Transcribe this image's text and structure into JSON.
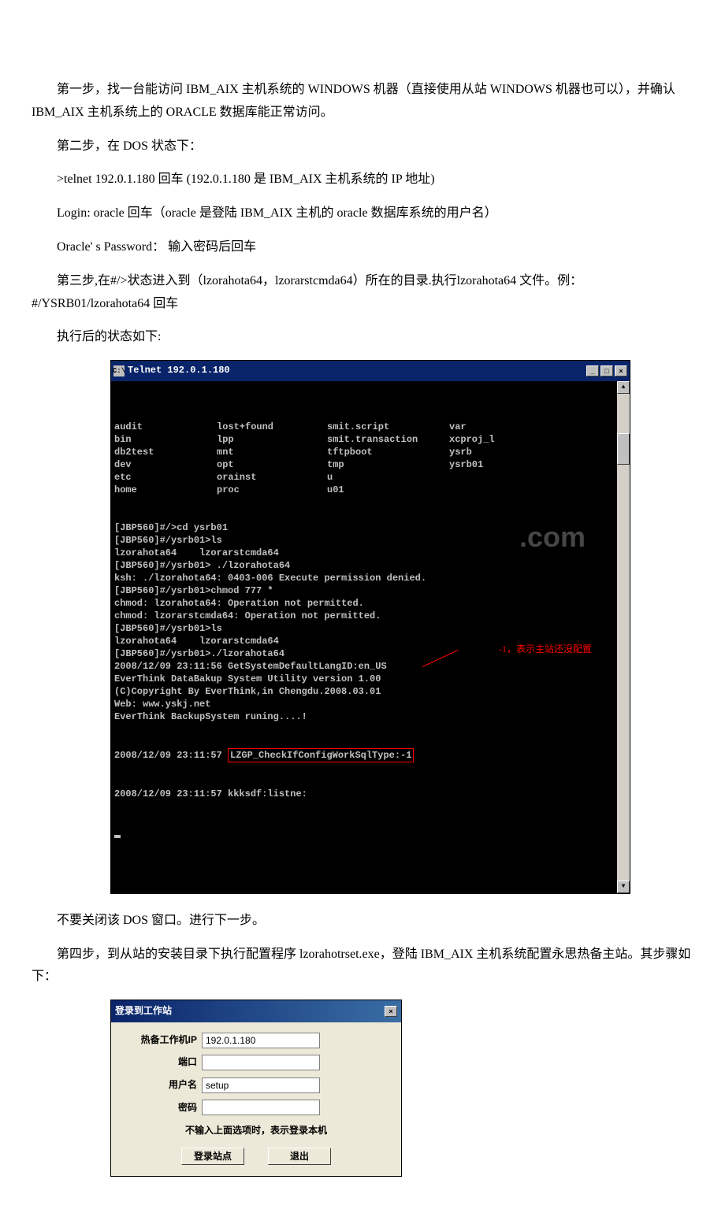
{
  "paragraphs": {
    "p1": "第一步，找一台能访问 IBM_AIX 主机系统的 WINDOWS 机器（直接使用从站 WINDOWS 机器也可以），并确认 IBM_AIX 主机系统上的 ORACLE 数据库能正常访问。",
    "p2": "第二步，在 DOS 状态下：",
    "p3": ">telnet 192.0.1.180 回车 (192.0.1.180 是 IBM_AIX 主机系统的 IP 地址)",
    "p4": "Login: oracle 回车（oracle 是登陆 IBM_AIX 主机的 oracle 数据库系统的用户名）",
    "p5": "Oracle' s Password： 输入密码后回车",
    "p6": "第三步,在#/>状态进入到（lzorahota64，lzorarstcmda64）所在的目录.执行lzorahota64 文件。例：#/YSRB01/lzorahota64 回车",
    "p7": "执行后的状态如下:",
    "p8": "不要关闭该 DOS 窗口。进行下一步。",
    "p9": "第四步，到从站的安装目录下执行配置程序 lzorahotrset.exe，登陆 IBM_AIX 主机系统配置永思热备主站。其步骤如下："
  },
  "telnet": {
    "icon_label": "C:\\",
    "title": "Telnet 192.0.1.180",
    "watermark": ".com",
    "annotation": "-1，表示主站还没配置",
    "ls_grid": [
      [
        "audit",
        "lost+found",
        "smit.script",
        "var"
      ],
      [
        "bin",
        "lpp",
        "smit.transaction",
        "xcproj_l"
      ],
      [
        "db2test",
        "mnt",
        "tftpboot",
        "ysrb"
      ],
      [
        "dev",
        "opt",
        "tmp",
        "ysrb01"
      ],
      [
        "etc",
        "orainst",
        "u",
        ""
      ],
      [
        "home",
        "proc",
        "u01",
        ""
      ]
    ],
    "lines": [
      "[JBP560]#/>cd ysrb01",
      "[JBP560]#/ysrb01>ls",
      "lzorahota64    lzorarstcmda64",
      "[JBP560]#/ysrb01> ./lzorahota64",
      "ksh: ./lzorahota64: 0403-006 Execute permission denied.",
      "[JBP560]#/ysrb01>chmod 777 *",
      "chmod: lzorahota64: Operation not permitted.",
      "chmod: lzorarstcmda64: Operation not permitted.",
      "[JBP560]#/ysrb01>ls",
      "lzorahota64    lzorarstcmda64",
      "[JBP560]#/ysrb01>./lzorahota64",
      "2008/12/09 23:11:56 GetSystemDefaultLangID:en_US",
      "EverThink DataBakup System Utility version 1.00",
      "(C)Copyright By EverThink,in Chengdu.2008.03.01",
      "Web: www.yskj.net",
      "EverThink BackupSystem runing....!"
    ],
    "redbox_prefix": "2008/12/09 23:11:57 ",
    "redbox_text": "LZGP_CheckIfConfigWorkSqlType:-1",
    "last_line": "2008/12/09 23:11:57 kkksdf:listne:"
  },
  "login": {
    "title": "登录到工作站",
    "labels": {
      "ip": "热备工作机IP",
      "port": "端口",
      "user": "用户名",
      "pass": "密码"
    },
    "values": {
      "ip": "192.0.1.180",
      "port": "",
      "user": "setup",
      "pass": ""
    },
    "hint": "不输入上面选项时，表示登录本机",
    "buttons": {
      "login": "登录站点",
      "exit": "退出"
    }
  }
}
